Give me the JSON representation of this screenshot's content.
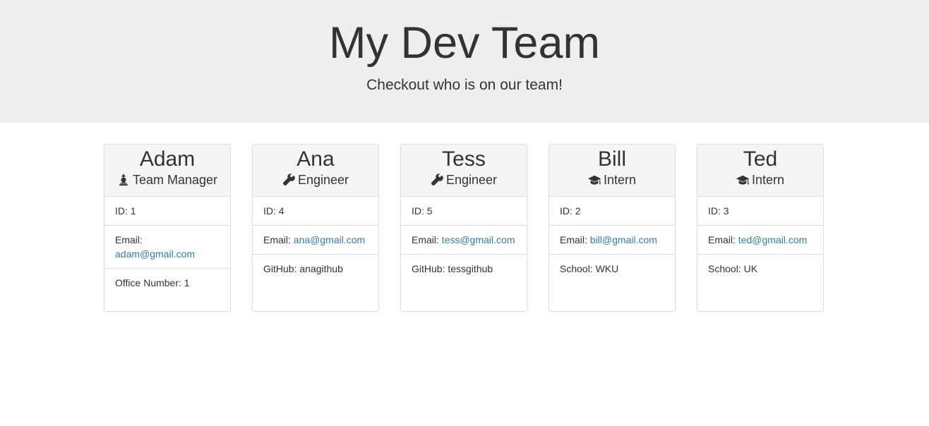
{
  "header": {
    "title": "My Dev Team",
    "subtitle": "Checkout who is on our team!"
  },
  "colors": {
    "link": "#337ab7",
    "header_bg": "#eeeeee",
    "card_head_bg": "#f5f5f5"
  },
  "team": [
    {
      "name": "Adam",
      "role": "Team Manager",
      "icon": "chess-king-icon",
      "id_label": "ID: 1",
      "email_label": "Email:",
      "email": "adam@gmail.com",
      "extra": "Office Number: 1"
    },
    {
      "name": "Ana",
      "role": "Engineer",
      "icon": "wrench-icon",
      "id_label": "ID: 4",
      "email_label": "Email:",
      "email": "ana@gmail.com",
      "extra": "GitHub: anagithub"
    },
    {
      "name": "Tess",
      "role": "Engineer",
      "icon": "wrench-icon",
      "id_label": "ID: 5",
      "email_label": "Email:",
      "email": "tess@gmail.com",
      "extra": "GitHub: tessgithub"
    },
    {
      "name": "Bill",
      "role": "Intern",
      "icon": "graduation-cap-icon",
      "id_label": "ID: 2",
      "email_label": "Email:",
      "email": "bill@gmail.com",
      "extra": "School: WKU"
    },
    {
      "name": "Ted",
      "role": "Intern",
      "icon": "graduation-cap-icon",
      "id_label": "ID: 3",
      "email_label": "Email:",
      "email": "ted@gmail.com",
      "extra": "School: UK"
    }
  ]
}
